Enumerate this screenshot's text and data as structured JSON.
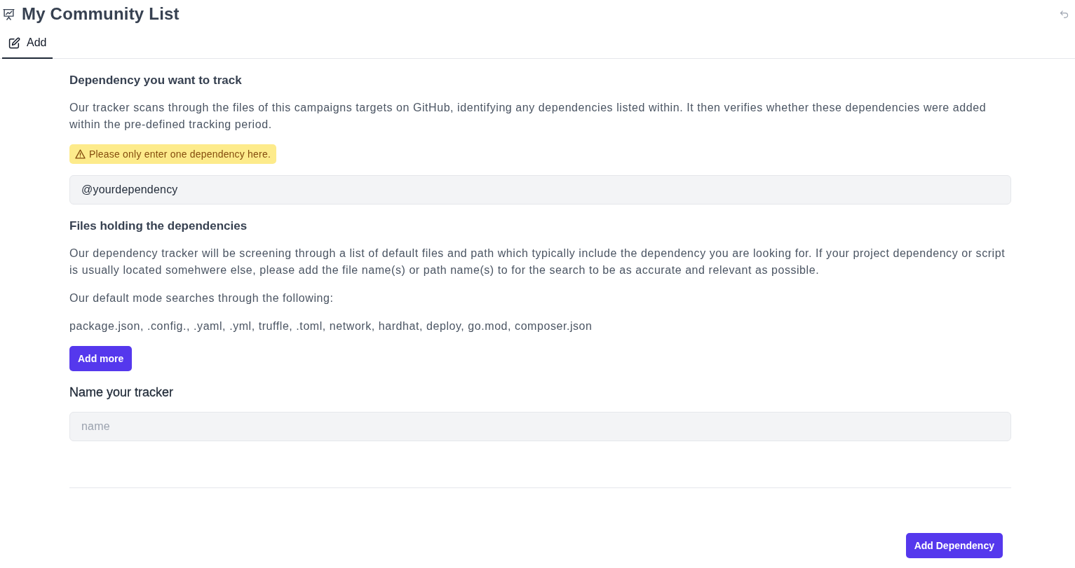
{
  "header": {
    "title": "My Community List"
  },
  "tabs": [
    {
      "label": "Add",
      "selected": true
    }
  ],
  "dependency_section": {
    "heading": "Dependency you want to track",
    "description": "Our tracker scans through the files of this campaigns targets on GitHub, identifying any dependencies listed within. It then verifies whether these dependencies were added within the pre-defined tracking period.",
    "warning": "Please only enter one dependency here.",
    "field": {
      "value": "@yourdependency"
    }
  },
  "files_section": {
    "heading": "Files holding the dependencies",
    "paragraphs": [
      "Our dependency tracker will be screening through a list of default files and path which typically include the dependency you are looking for. If your project dependency or script is usually located somehwere else, please add the file name(s) or path name(s) to for the search to be as accurate and relevant as possible.",
      "Our default mode searches through the following:",
      "package.json, .config., .yaml, .yml, truffle, .toml, network, hardhat, deploy, go.mod, composer.json"
    ],
    "button": "Add more"
  },
  "name_section": {
    "heading": "Name your tracker",
    "field": {
      "placeholder": "name"
    }
  },
  "footer": {
    "submit_button": "Add Dependency"
  }
}
